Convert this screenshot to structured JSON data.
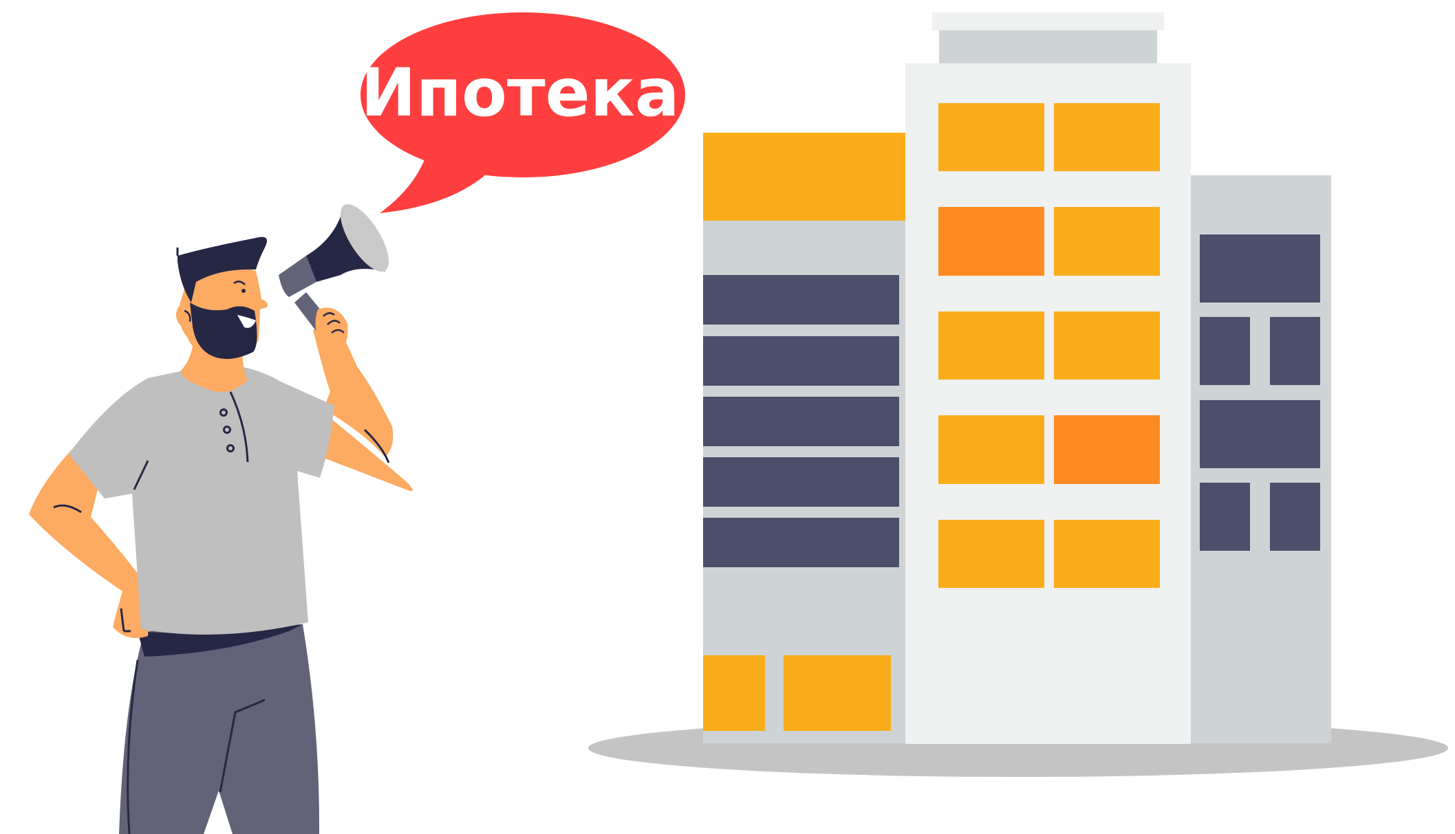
{
  "speech_bubble": {
    "text": "Ипотека"
  },
  "colors": {
    "bubble_red": "#ff3f3f",
    "window_yellow": "#f9ad1b",
    "window_orange": "#fd8b23",
    "window_dark": "#4b4f6b",
    "building_light_gray": "#eff0f0",
    "building_blue_gray": "#ced3d6",
    "ground_shadow": "#c4c4c4",
    "skin": "#fdaa63",
    "shirt": "#bfbfbf",
    "pants": "#626378",
    "hair_beard": "#262745"
  },
  "icons": {
    "person": "man-with-megaphone-illustration",
    "megaphone": "megaphone-icon",
    "building": "apartment-building-illustration"
  }
}
